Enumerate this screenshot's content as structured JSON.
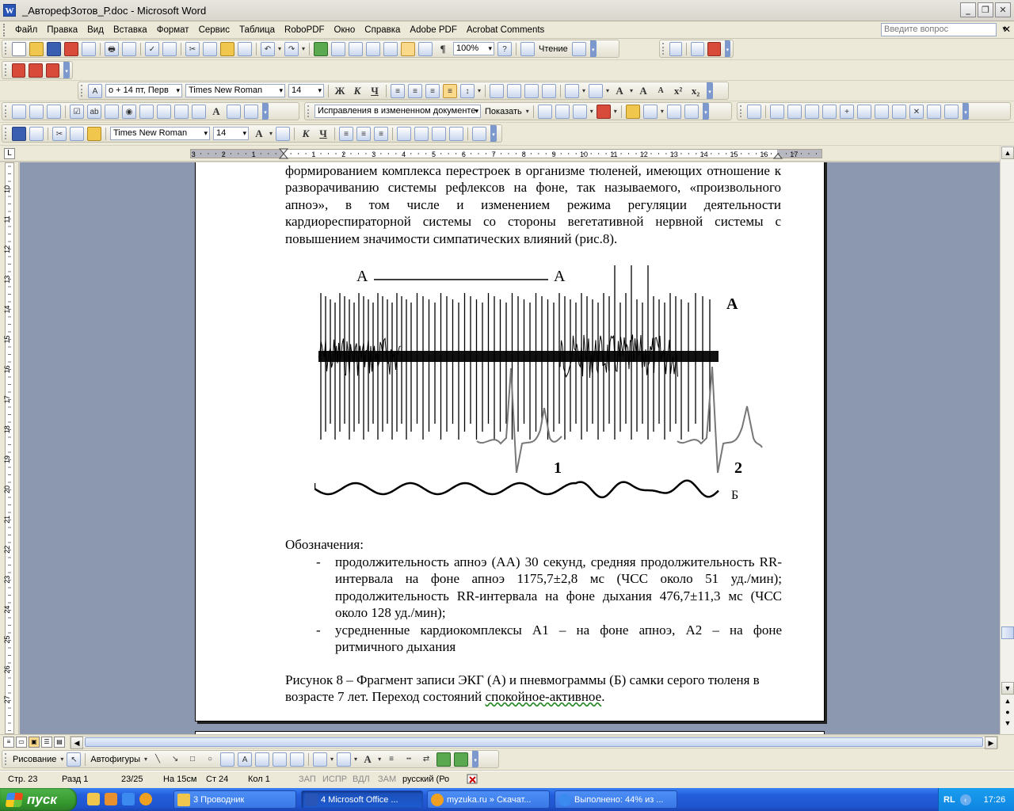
{
  "window": {
    "title": "_АвторефЗотов_Р.doc - Microsoft Word",
    "app_icon_letter": "W"
  },
  "menu": {
    "items": [
      "Файл",
      "Правка",
      "Вид",
      "Вставка",
      "Формат",
      "Сервис",
      "Таблица",
      "RoboPDF",
      "Окно",
      "Справка",
      "Adobe PDF",
      "Acrobat Comments"
    ],
    "ask_placeholder": "Введите вопрос"
  },
  "toolbar": {
    "zoom": "100%",
    "read_label": "Чтение",
    "style_value": "о + 14 пт, Перв",
    "font_value": "Times New Roman",
    "size_value": "14",
    "bold_label": "Ж",
    "italic_label": "К",
    "underline_label": "Ч",
    "track_changes_value": "Исправления в измененном документе",
    "show_label": "Показать",
    "font2_value": "Times New Roman",
    "size2_value": "14"
  },
  "ruler": {
    "left_numbers": [
      "3",
      "2",
      "1"
    ],
    "right_numbers": [
      "1",
      "2",
      "3",
      "4",
      "5",
      "6",
      "7",
      "8",
      "9",
      "10",
      "11",
      "12",
      "13",
      "14",
      "15",
      "16",
      "17"
    ],
    "vertical_numbers": [
      "10",
      "11",
      "12",
      "13",
      "14",
      "15",
      "16",
      "17",
      "18",
      "19",
      "20",
      "21",
      "22",
      "23",
      "24",
      "25",
      "26",
      "27"
    ]
  },
  "document": {
    "paragraph1": "формированием комплекса перестроек в организме тюленей, имеющих отношение к разворачиванию системы рефлексов на фоне, так называемого, «произвольного апноэ», в том числе и изменением режима регуляции деятельности кардиореспираторной системы со стороны вегетативной нервной системы с повышением значимости симпатических влияний (рис.8).",
    "figure": {
      "label_a_left": "А",
      "label_a_right": "А",
      "label_a_series": "А",
      "label_1": "1",
      "label_2": "2",
      "label_b": "Б"
    },
    "legend_heading": "Обозначения:",
    "legend_items": [
      "продолжительность апноэ (АА) 30 секунд, средняя продолжительность RR-интервала на фоне апноэ 1175,7±2,8 мс (ЧСС около 51 уд./мин); продолжительность RR-интервала на фоне дыхания 476,7±11,3 мс (ЧСС около 128 уд./мин);",
      "усредненные кардиокомплексы А1 – на фоне апноэ, А2 – на фоне ритмичного дыхания"
    ],
    "legend_dash": "-",
    "caption_part1": "Рисунок 8  – Фрагмент записи ЭКГ (А) и пневмограммы (Б) самки серого тюленя в возрасте 7 лет. Переход состояний ",
    "caption_underlined": "спокойное-активное",
    "caption_end": "."
  },
  "drawing_toolbar": {
    "draw_label": "Рисование",
    "autoshapes_label": "Автофигуры"
  },
  "status": {
    "page": "Стр. 23",
    "section": "Разд 1",
    "pages": "23/25",
    "at": "На 15см",
    "line": "Ст 24",
    "col": "Кол 1",
    "rec": "ЗАП",
    "trk": "ИСПР",
    "ext": "ВДЛ",
    "ovr": "ЗАМ",
    "lang": "русский (Ро"
  },
  "taskbar": {
    "start_label": "пуск",
    "tasks": [
      {
        "label": "3 Проводник"
      },
      {
        "label": "4 Microsoft Office ..."
      },
      {
        "label": "myzuka.ru » Скачат..."
      },
      {
        "label": "Выполнено: 44% из ..."
      }
    ],
    "lang_indicator": "RL",
    "clock": "17:26"
  },
  "colors": {
    "taskbar_blue": "#245edb",
    "start_green": "#369a2f",
    "workspace": "#8c98b0"
  }
}
